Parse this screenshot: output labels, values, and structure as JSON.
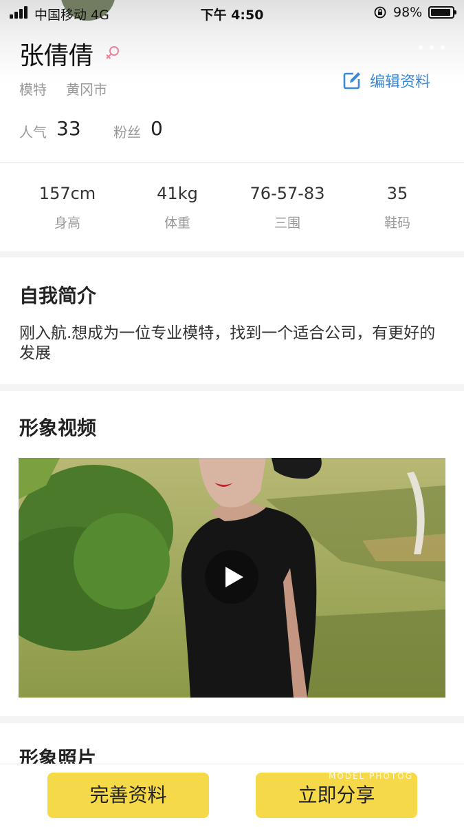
{
  "status_bar": {
    "carrier": "中国移动 4G",
    "time": "下午 4:50",
    "battery": "98%"
  },
  "profile": {
    "name": "张倩倩",
    "role": "模特",
    "city": "黄冈市",
    "edit_label": "编辑资料",
    "popularity_label": "人气",
    "popularity_value": "33",
    "fans_label": "粉丝",
    "fans_value": "0",
    "gender_color": "#e8839a"
  },
  "measurements": [
    {
      "value": "157cm",
      "label": "身高"
    },
    {
      "value": "41kg",
      "label": "体重"
    },
    {
      "value": "76-57-83",
      "label": "三围"
    },
    {
      "value": "35",
      "label": "鞋码"
    }
  ],
  "intro": {
    "title": "自我简介",
    "text": "刚入航.想成为一位专业模特，找到一个适合公司，有更好的发展"
  },
  "video_section": {
    "title": "形象视频"
  },
  "photo_section": {
    "title": "形象照片"
  },
  "actions": {
    "complete_label": "完善资料",
    "share_label": "立即分享"
  },
  "watermark": "MODEL PHOTOG",
  "colors": {
    "accent_yellow": "#f6d948",
    "link_blue": "#3b88d6"
  }
}
